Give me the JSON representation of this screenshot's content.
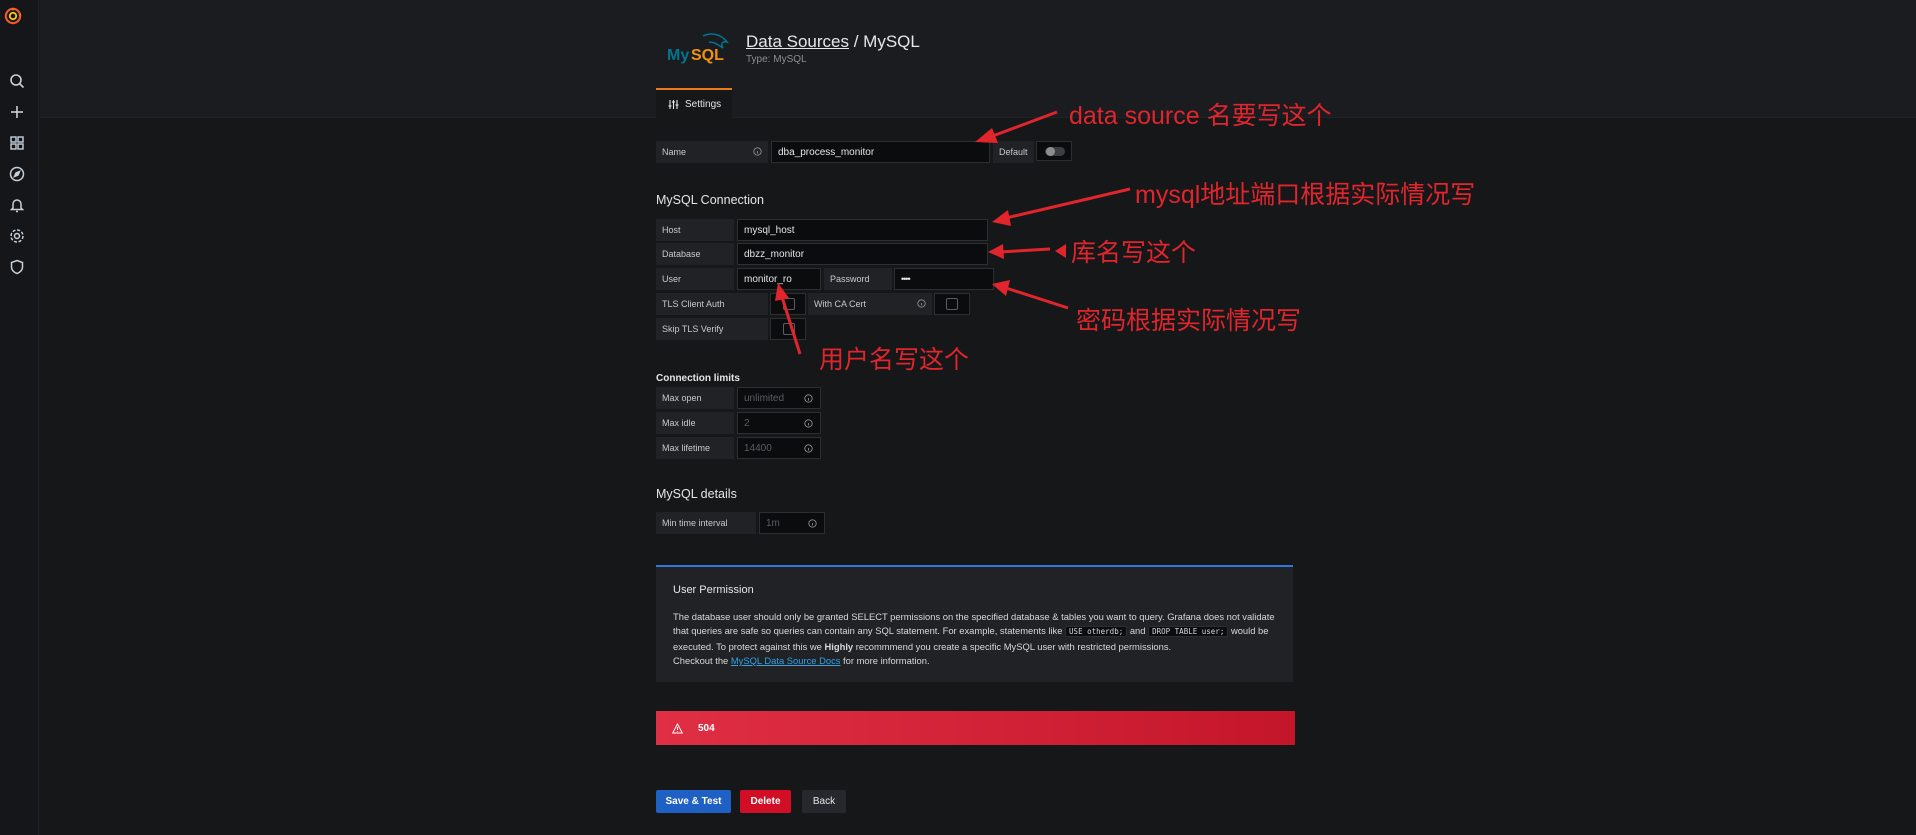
{
  "header": {
    "breadcrumb_link": "Data Sources",
    "separator": " / ",
    "title": "MySQL",
    "subtitle": "Type: MySQL",
    "logo_text": "MySQL"
  },
  "tabs": [
    {
      "label": "Settings",
      "active": true
    }
  ],
  "name_field": {
    "label": "Name",
    "value": "dba_process_monitor",
    "default_label": "Default",
    "default_on": false
  },
  "connection": {
    "title": "MySQL Connection",
    "host": {
      "label": "Host",
      "value": "mysql_host"
    },
    "database": {
      "label": "Database",
      "value": "dbzz_monitor"
    },
    "user": {
      "label": "User",
      "value": "monitor_ro"
    },
    "password": {
      "label": "Password",
      "value": "••••"
    },
    "tls_client_auth": {
      "label": "TLS Client Auth",
      "checked": false
    },
    "with_ca_cert": {
      "label": "With CA Cert",
      "checked": false
    },
    "skip_tls_verify": {
      "label": "Skip TLS Verify",
      "checked": false
    }
  },
  "limits": {
    "title": "Connection limits",
    "max_open": {
      "label": "Max open",
      "placeholder": "unlimited"
    },
    "max_idle": {
      "label": "Max idle",
      "placeholder": "2"
    },
    "max_lifetime": {
      "label": "Max lifetime",
      "placeholder": "14400"
    }
  },
  "details": {
    "title": "MySQL details",
    "min_time_interval": {
      "label": "Min time interval",
      "placeholder": "1m"
    }
  },
  "permission": {
    "title": "User Permission",
    "text_1": "The database user should only be granted SELECT permissions on the specified database & tables you want to query. Grafana does not validate that queries are safe so queries can contain any SQL statement. For example, statements like ",
    "code_1": "USE otherdb;",
    "and": " and ",
    "code_2": "DROP TABLE user;",
    "text_2": " would be executed. To protect against this we ",
    "highly": "Highly",
    "text_3": " recommmend you create a specific MySQL user with restricted permissions.",
    "checkout": "Checkout the ",
    "docs_link": "MySQL Data Source Docs",
    "text_4": " for more information."
  },
  "error": {
    "message": "504"
  },
  "buttons": {
    "save": "Save & Test",
    "delete": "Delete",
    "back": "Back"
  },
  "annotations": {
    "name": "data source 名要写这个",
    "host": "mysql地址端口根据实际情况写",
    "database": "库名写这个",
    "password": "密码根据实际情况写",
    "user": "用户名写这个"
  },
  "colors": {
    "background": "#161719",
    "panel": "#202226",
    "accent_tab": "#eb7b18",
    "primary": "#1f60c4",
    "danger": "#d10e25",
    "error_banner": "#e02f44",
    "annotation": "#e0252d",
    "link": "#33a2e5"
  },
  "icons": [
    "grafana-logo",
    "search-icon",
    "plus-icon",
    "dashboards-icon",
    "explore-icon",
    "alerting-icon",
    "configuration-icon",
    "shield-icon",
    "settings-sliders-icon",
    "info-icon",
    "warning-icon"
  ]
}
